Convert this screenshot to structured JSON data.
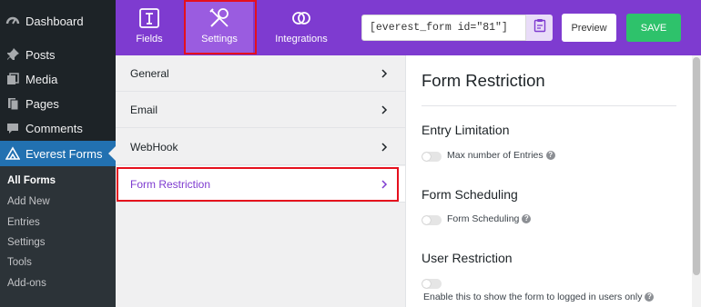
{
  "wp_menu": {
    "items": [
      {
        "label": "Dashboard",
        "icon": "dashboard-icon"
      },
      {
        "label": "Posts",
        "icon": "pushpin-icon"
      },
      {
        "label": "Media",
        "icon": "media-icon"
      },
      {
        "label": "Pages",
        "icon": "pages-icon"
      },
      {
        "label": "Comments",
        "icon": "comment-icon"
      },
      {
        "label": "Everest Forms",
        "icon": "everest-forms-icon"
      }
    ],
    "submenu": [
      "All Forms",
      "Add New",
      "Entries",
      "Settings",
      "Tools",
      "Add-ons"
    ]
  },
  "header": {
    "tabs": [
      {
        "label": "Fields",
        "icon": "fields-icon"
      },
      {
        "label": "Settings",
        "icon": "settings-tools-icon"
      },
      {
        "label": "Integrations",
        "icon": "integrations-icon"
      }
    ],
    "shortcode": "[everest_form id=\"81\"]",
    "preview_label": "Preview",
    "save_label": "SAVE"
  },
  "settings_nav": {
    "items": [
      "General",
      "Email",
      "WebHook",
      "Form Restriction"
    ]
  },
  "content": {
    "title": "Form Restriction",
    "sections": [
      {
        "heading": "Entry Limitation",
        "option": "Max number of Entries"
      },
      {
        "heading": "Form Scheduling",
        "option": "Form Scheduling"
      },
      {
        "heading": "User Restriction",
        "option": ""
      }
    ],
    "user_restriction_desc": "Enable this to show the form to logged in users only",
    "help_glyph": "?"
  },
  "colors": {
    "header_purple": "#7e3bd0",
    "active_tab": "#9a5ce0",
    "save_green": "#2ec26b",
    "highlight_red": "#e5101d",
    "wp_active_blue": "#2271b1"
  }
}
